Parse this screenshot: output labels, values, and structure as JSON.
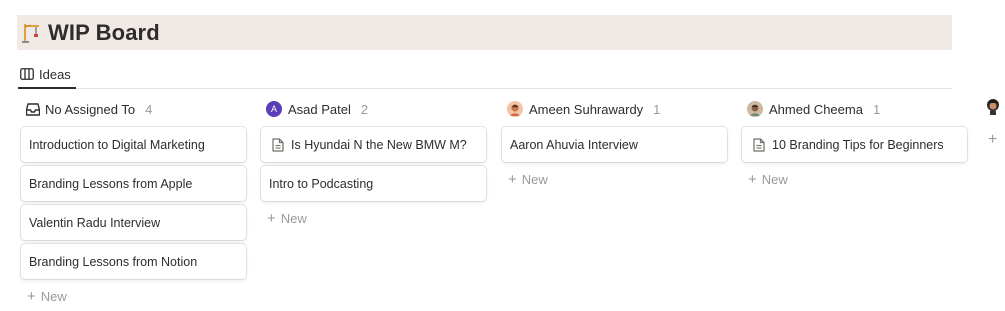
{
  "page": {
    "title": "WIP Board",
    "title_icon": "construction-crane-icon"
  },
  "view_tab": {
    "label": "Ideas",
    "icon": "board-columns-icon"
  },
  "columns": [
    {
      "name": "No Assigned To",
      "count": "4",
      "icon": "inbox-tray-icon",
      "cards": [
        {
          "title": "Introduction to Digital Marketing",
          "has_doc_icon": false
        },
        {
          "title": "Branding Lessons from Apple",
          "has_doc_icon": false
        },
        {
          "title": "Valentin Radu Interview",
          "has_doc_icon": false
        },
        {
          "title": "Branding Lessons from Notion",
          "has_doc_icon": false
        }
      ],
      "new_label": "New"
    },
    {
      "name": "Asad Patel",
      "count": "2",
      "avatar_letter": "A",
      "avatar_color": "#5b3db8",
      "cards": [
        {
          "title": "Is Hyundai N the New BMW M?",
          "has_doc_icon": true
        },
        {
          "title": "Intro to Podcasting",
          "has_doc_icon": false
        }
      ],
      "new_label": "New"
    },
    {
      "name": "Ameen Suhrawardy",
      "count": "1",
      "avatar_color": "#d98b6a",
      "cards": [
        {
          "title": "Aaron Ahuvia Interview",
          "has_doc_icon": false
        }
      ],
      "new_label": "New"
    },
    {
      "name": "Ahmed Cheema",
      "count": "1",
      "avatar_color": "#a07a5c",
      "cards": [
        {
          "title": "10 Branding Tips for Beginners",
          "has_doc_icon": true
        }
      ],
      "new_label": "New"
    }
  ],
  "colors": {
    "header_bg": "#f1e9e6",
    "text": "#2f2d2a",
    "muted": "#9b9a97"
  }
}
